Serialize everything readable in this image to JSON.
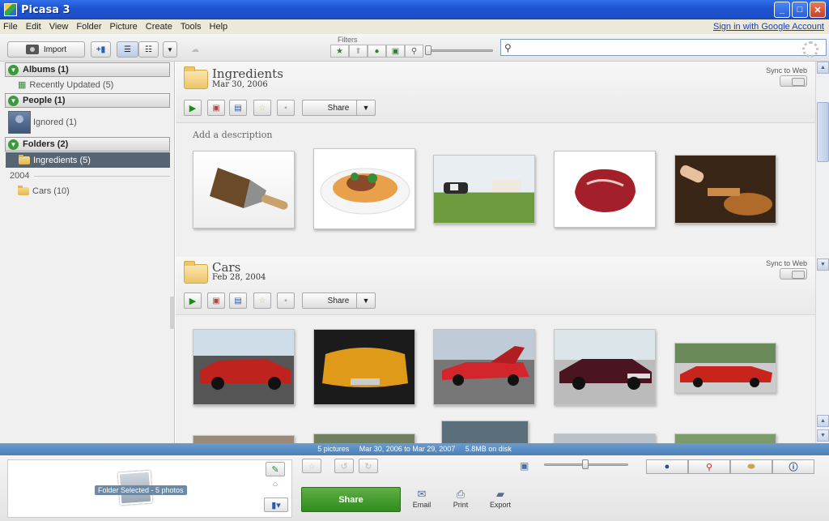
{
  "window": {
    "title": "Picasa 3"
  },
  "menu": {
    "items": [
      "File",
      "Edit",
      "View",
      "Folder",
      "Picture",
      "Create",
      "Tools",
      "Help"
    ],
    "signin": "Sign in with Google Account"
  },
  "toolbar": {
    "import_label": "Import",
    "filters_label": "Filters",
    "search": {
      "value": "",
      "placeholder": ""
    }
  },
  "sidebar": {
    "albums_header": "Albums (1)",
    "albums_items": [
      {
        "label": "Recently Updated (5)"
      }
    ],
    "people_header": "People (1)",
    "people_items": [
      {
        "label": "Ignored (1)"
      }
    ],
    "folders_header": "Folders (2)",
    "folders_selected": "Ingredients (5)",
    "year": "2004",
    "folders_items": [
      {
        "label": "Cars (10)"
      }
    ]
  },
  "sections": [
    {
      "title": "Ingredients",
      "date": "Mar 30, 2006",
      "sync_label": "Sync to Web",
      "share_label": "Share",
      "description_placeholder": "Add a description",
      "photos": [
        "paintbrush",
        "pasta-dish",
        "cows",
        "raw-steak",
        "grill-cooking"
      ]
    },
    {
      "title": "Cars",
      "date": "Feb 28, 2004",
      "sync_label": "Sync to Web",
      "share_label": "Share",
      "photos": [
        "red-classic-car",
        "orange-muscle-car",
        "red-car-hood-open",
        "maroon-classic-car",
        "red-muscle-car"
      ]
    }
  ],
  "status": {
    "text": "5 pictures     Mar 30, 2006 to Mar 29, 2007     5.8MB on disk"
  },
  "bottom": {
    "tray_badge": "Folder Selected - 5 photos",
    "share_label": "Share",
    "email_label": "Email",
    "print_label": "Print",
    "export_label": "Export"
  },
  "colors": {
    "titlebar": "#1f55d0",
    "selection": "#576573",
    "statusbar": "#5a8ec4",
    "share_green": "#3f9a2c"
  }
}
